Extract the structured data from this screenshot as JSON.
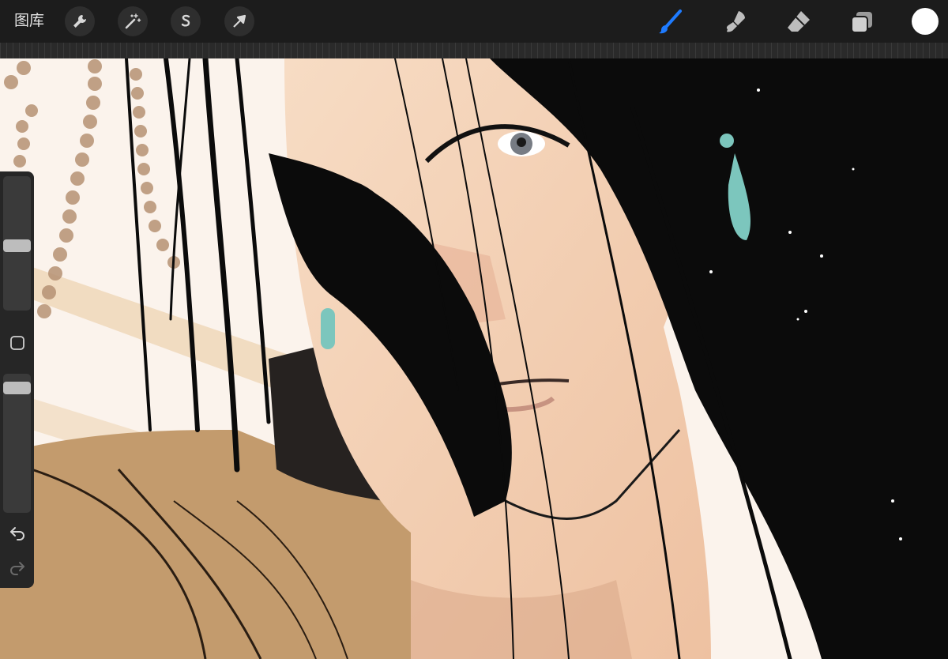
{
  "toolbar": {
    "gallery_label": "图库",
    "left_tools": [
      {
        "name": "actions",
        "icon": "wrench-icon"
      },
      {
        "name": "adjustments",
        "icon": "magic-wand-icon"
      },
      {
        "name": "selection",
        "icon": "selection-s-icon"
      },
      {
        "name": "transform",
        "icon": "arrow-cursor-icon"
      }
    ],
    "right_tools": [
      {
        "name": "brush",
        "icon": "brush-icon",
        "active": true
      },
      {
        "name": "smudge",
        "icon": "smudge-icon"
      },
      {
        "name": "eraser",
        "icon": "eraser-icon"
      },
      {
        "name": "layers",
        "icon": "layers-icon"
      }
    ],
    "active_color": "#ffffff",
    "accent_color": "#1e7bff"
  },
  "sidebar": {
    "brush_size_level": 0.52,
    "opacity_level": 0.06,
    "modify_button_icon": "square-icon",
    "undo_icon": "undo-icon",
    "redo_icon": "redo-icon"
  },
  "canvas": {
    "artwork": "illustration-portrait",
    "palette": {
      "background": "#fbf3ec",
      "skin": "#f4d1b5",
      "hair": "#0b0b0b",
      "robe": "#c39b6d",
      "earring": "#7cc6bd",
      "beads": "#c8a27a"
    }
  }
}
